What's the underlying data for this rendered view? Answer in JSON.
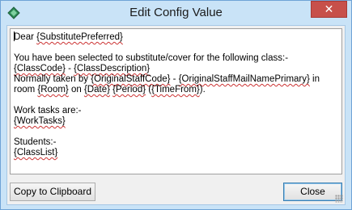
{
  "window": {
    "title": "Edit Config Value",
    "close_glyph": "✕"
  },
  "editor": {
    "lines": [
      [
        {
          "t": "Dear "
        },
        {
          "t": "{SubstitutePreferred}",
          "token": true
        }
      ],
      [
        {
          "t": ""
        }
      ],
      [
        {
          "t": "You have been selected to substitute/cover for the following class:-"
        }
      ],
      [
        {
          "t": "{ClassCode}",
          "token": true
        },
        {
          "t": " - "
        },
        {
          "t": "{ClassDescription}",
          "token": true
        }
      ],
      [
        {
          "t": "Normally taken by "
        },
        {
          "t": "{OriginalStaffCode}",
          "token": true
        },
        {
          "t": " - "
        },
        {
          "t": "{OriginalStaffMailNamePrimary}",
          "token": true
        },
        {
          "t": " in room "
        },
        {
          "t": "{Room}",
          "token": true
        },
        {
          "t": " on "
        },
        {
          "t": "{Date}",
          "token": true
        },
        {
          "t": " "
        },
        {
          "t": "{Period}",
          "token": true
        },
        {
          "t": " ("
        },
        {
          "t": "{TimeFrom}",
          "token": true
        },
        {
          "t": ")."
        }
      ],
      [
        {
          "t": ""
        }
      ],
      [
        {
          "t": "Work tasks are:-"
        }
      ],
      [
        {
          "t": "{WorkTasks}",
          "token": true
        }
      ],
      [
        {
          "t": ""
        }
      ],
      [
        {
          "t": "Students:-"
        }
      ],
      [
        {
          "t": "{ClassList}",
          "token": true
        }
      ]
    ]
  },
  "buttons": {
    "copy_label": "Copy to Clipboard",
    "close_label": "Close"
  },
  "icons": {
    "app": "app-diamond-icon",
    "close": "close-icon",
    "grip": "resize-grip-icon"
  },
  "colors": {
    "title_bar": "#c9e3f7",
    "close_button": "#c7504a",
    "spell_underline": "#cc3333"
  }
}
